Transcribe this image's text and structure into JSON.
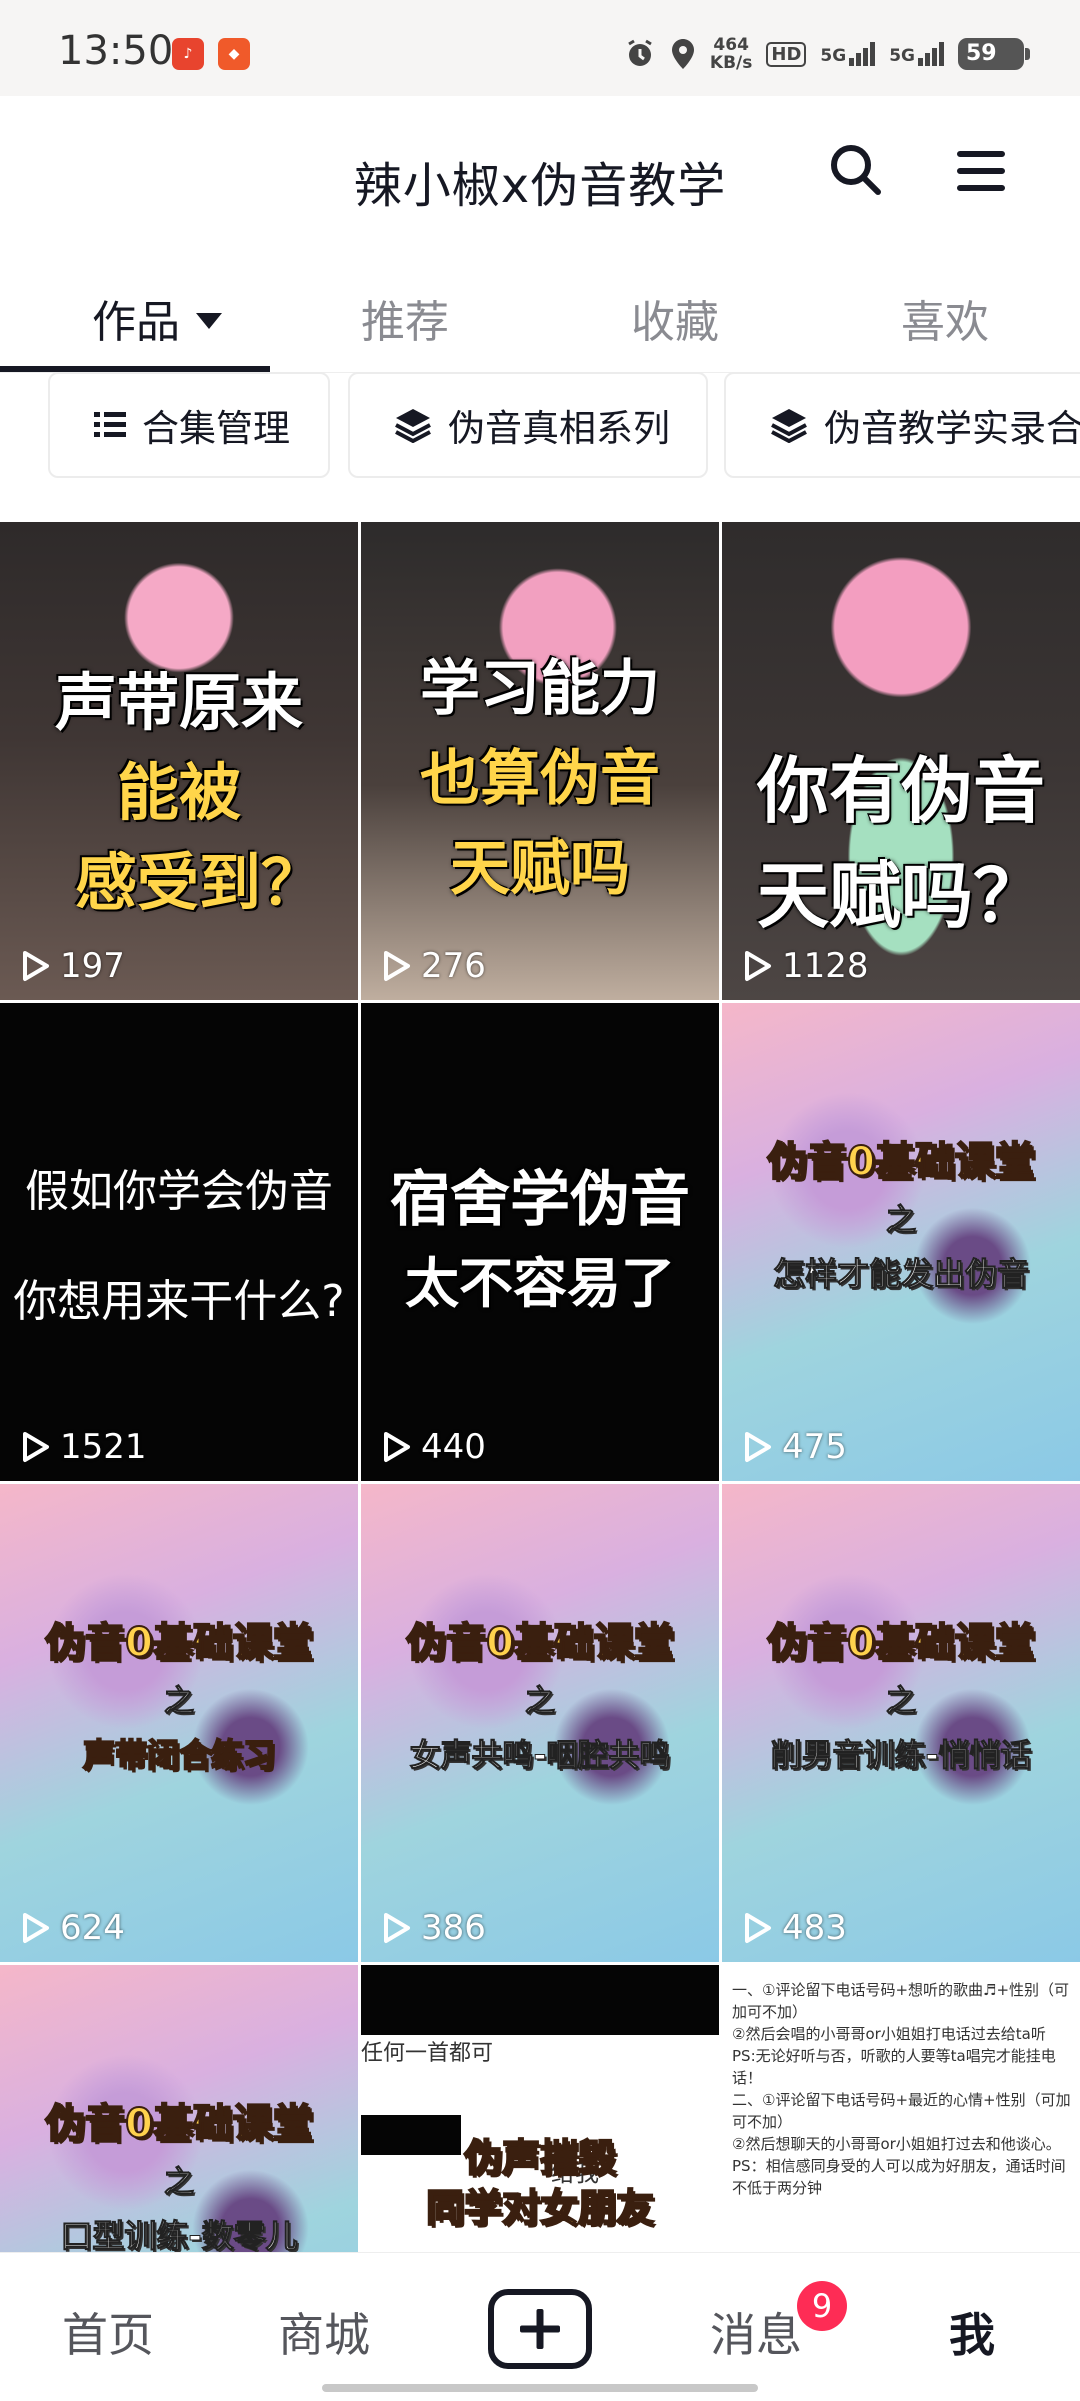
{
  "status_bar": {
    "time": "13:50",
    "net_speed_value": "464",
    "net_speed_unit": "KB/s",
    "hd": "HD",
    "sim1": "5G",
    "sim2": "5G",
    "battery": "59"
  },
  "header": {
    "title": "辣小椒x伪音教学"
  },
  "tabs": [
    {
      "label": "作品",
      "active": true
    },
    {
      "label": "推荐",
      "active": false
    },
    {
      "label": "收藏",
      "active": false
    },
    {
      "label": "喜欢",
      "active": false
    }
  ],
  "chips": [
    {
      "label": "合集管理",
      "icon": "list-icon"
    },
    {
      "label": "伪音真相系列",
      "icon": "layers-icon"
    },
    {
      "label": "伪音教学实录合",
      "icon": "layers-icon"
    }
  ],
  "videos": [
    {
      "line1": "声带原来",
      "line2": "能被",
      "line3": "感受到？",
      "plays": "197"
    },
    {
      "line1": "学习能力",
      "line2": "也算伪音",
      "line3": "天赋吗",
      "plays": "276"
    },
    {
      "line1": "你有伪音",
      "line2": "天赋吗？",
      "plays": "1128"
    },
    {
      "line1": "假如你学会伪音",
      "line2": "你想用来干什么?",
      "plays": "1521"
    },
    {
      "line1": "宿舍学伪音",
      "line2": "太不容易了",
      "plays": "440"
    },
    {
      "line1": "伪音0基础课堂",
      "line2": "之",
      "line3": "怎样才能发出伪音",
      "plays": "475"
    },
    {
      "line1": "伪音0基础课堂",
      "line2": "之",
      "line3": "声带闭合练习",
      "plays": "624"
    },
    {
      "line1": "伪音0基础课堂",
      "line2": "之",
      "line3": "女声共鸣-咽腔共鸣",
      "plays": "386"
    },
    {
      "line1": "伪音0基础课堂",
      "line2": "之",
      "line3": "削男音训练-悄悄话",
      "plays": "483"
    },
    {
      "line1": "伪音0基础课堂",
      "line2": "之",
      "line3": "口型训练-数零儿"
    },
    {
      "chat1": "任何一首都可",
      "chat2": "给我",
      "line1": "伪声摧毁",
      "line2": "同学对女朋友"
    },
    {
      "text": [
        "一、①评论留下电话号码+想听的歌曲♬+性别（可加可不加）",
        "②然后会唱的小哥哥or小姐姐打电话过去给ta听",
        "PS:无论好听与否，听歌的人要等ta唱完才能挂电话！",
        "二、①评论留下电话号码+最近的心情+性别（可加可不加）",
        "②然后想聊天的小哥哥or小姐姐打过去和他谈心。",
        "PS：相信感同身受的人可以成为好朋友，通话时间不低于两分钟"
      ]
    }
  ],
  "bottom_nav": [
    {
      "label": "首页",
      "active": false
    },
    {
      "label": "商城",
      "active": false
    },
    {
      "label": "消息",
      "active": false,
      "badge": "9"
    },
    {
      "label": "我",
      "active": true
    }
  ],
  "colors": {
    "badge": "#fe2c55",
    "active_text": "#161823",
    "inactive_text": "#8a8b91"
  }
}
